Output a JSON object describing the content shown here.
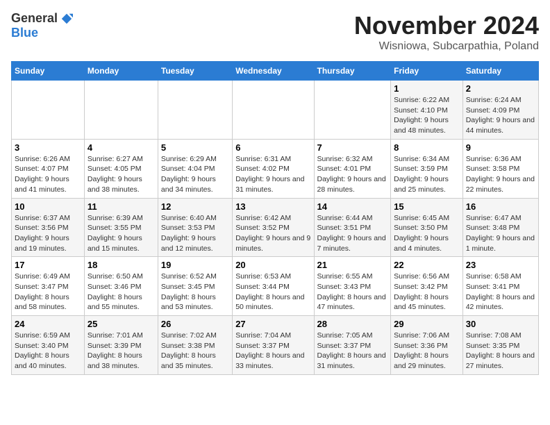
{
  "logo": {
    "general": "General",
    "blue": "Blue"
  },
  "title": "November 2024",
  "subtitle": "Wisniowa, Subcarpathia, Poland",
  "days_of_week": [
    "Sunday",
    "Monday",
    "Tuesday",
    "Wednesday",
    "Thursday",
    "Friday",
    "Saturday"
  ],
  "weeks": [
    [
      {
        "day": "",
        "info": ""
      },
      {
        "day": "",
        "info": ""
      },
      {
        "day": "",
        "info": ""
      },
      {
        "day": "",
        "info": ""
      },
      {
        "day": "",
        "info": ""
      },
      {
        "day": "1",
        "info": "Sunrise: 6:22 AM\nSunset: 4:10 PM\nDaylight: 9 hours and 48 minutes."
      },
      {
        "day": "2",
        "info": "Sunrise: 6:24 AM\nSunset: 4:09 PM\nDaylight: 9 hours and 44 minutes."
      }
    ],
    [
      {
        "day": "3",
        "info": "Sunrise: 6:26 AM\nSunset: 4:07 PM\nDaylight: 9 hours and 41 minutes."
      },
      {
        "day": "4",
        "info": "Sunrise: 6:27 AM\nSunset: 4:05 PM\nDaylight: 9 hours and 38 minutes."
      },
      {
        "day": "5",
        "info": "Sunrise: 6:29 AM\nSunset: 4:04 PM\nDaylight: 9 hours and 34 minutes."
      },
      {
        "day": "6",
        "info": "Sunrise: 6:31 AM\nSunset: 4:02 PM\nDaylight: 9 hours and 31 minutes."
      },
      {
        "day": "7",
        "info": "Sunrise: 6:32 AM\nSunset: 4:01 PM\nDaylight: 9 hours and 28 minutes."
      },
      {
        "day": "8",
        "info": "Sunrise: 6:34 AM\nSunset: 3:59 PM\nDaylight: 9 hours and 25 minutes."
      },
      {
        "day": "9",
        "info": "Sunrise: 6:36 AM\nSunset: 3:58 PM\nDaylight: 9 hours and 22 minutes."
      }
    ],
    [
      {
        "day": "10",
        "info": "Sunrise: 6:37 AM\nSunset: 3:56 PM\nDaylight: 9 hours and 19 minutes."
      },
      {
        "day": "11",
        "info": "Sunrise: 6:39 AM\nSunset: 3:55 PM\nDaylight: 9 hours and 15 minutes."
      },
      {
        "day": "12",
        "info": "Sunrise: 6:40 AM\nSunset: 3:53 PM\nDaylight: 9 hours and 12 minutes."
      },
      {
        "day": "13",
        "info": "Sunrise: 6:42 AM\nSunset: 3:52 PM\nDaylight: 9 hours and 9 minutes."
      },
      {
        "day": "14",
        "info": "Sunrise: 6:44 AM\nSunset: 3:51 PM\nDaylight: 9 hours and 7 minutes."
      },
      {
        "day": "15",
        "info": "Sunrise: 6:45 AM\nSunset: 3:50 PM\nDaylight: 9 hours and 4 minutes."
      },
      {
        "day": "16",
        "info": "Sunrise: 6:47 AM\nSunset: 3:48 PM\nDaylight: 9 hours and 1 minute."
      }
    ],
    [
      {
        "day": "17",
        "info": "Sunrise: 6:49 AM\nSunset: 3:47 PM\nDaylight: 8 hours and 58 minutes."
      },
      {
        "day": "18",
        "info": "Sunrise: 6:50 AM\nSunset: 3:46 PM\nDaylight: 8 hours and 55 minutes."
      },
      {
        "day": "19",
        "info": "Sunrise: 6:52 AM\nSunset: 3:45 PM\nDaylight: 8 hours and 53 minutes."
      },
      {
        "day": "20",
        "info": "Sunrise: 6:53 AM\nSunset: 3:44 PM\nDaylight: 8 hours and 50 minutes."
      },
      {
        "day": "21",
        "info": "Sunrise: 6:55 AM\nSunset: 3:43 PM\nDaylight: 8 hours and 47 minutes."
      },
      {
        "day": "22",
        "info": "Sunrise: 6:56 AM\nSunset: 3:42 PM\nDaylight: 8 hours and 45 minutes."
      },
      {
        "day": "23",
        "info": "Sunrise: 6:58 AM\nSunset: 3:41 PM\nDaylight: 8 hours and 42 minutes."
      }
    ],
    [
      {
        "day": "24",
        "info": "Sunrise: 6:59 AM\nSunset: 3:40 PM\nDaylight: 8 hours and 40 minutes."
      },
      {
        "day": "25",
        "info": "Sunrise: 7:01 AM\nSunset: 3:39 PM\nDaylight: 8 hours and 38 minutes."
      },
      {
        "day": "26",
        "info": "Sunrise: 7:02 AM\nSunset: 3:38 PM\nDaylight: 8 hours and 35 minutes."
      },
      {
        "day": "27",
        "info": "Sunrise: 7:04 AM\nSunset: 3:37 PM\nDaylight: 8 hours and 33 minutes."
      },
      {
        "day": "28",
        "info": "Sunrise: 7:05 AM\nSunset: 3:37 PM\nDaylight: 8 hours and 31 minutes."
      },
      {
        "day": "29",
        "info": "Sunrise: 7:06 AM\nSunset: 3:36 PM\nDaylight: 8 hours and 29 minutes."
      },
      {
        "day": "30",
        "info": "Sunrise: 7:08 AM\nSunset: 3:35 PM\nDaylight: 8 hours and 27 minutes."
      }
    ]
  ]
}
